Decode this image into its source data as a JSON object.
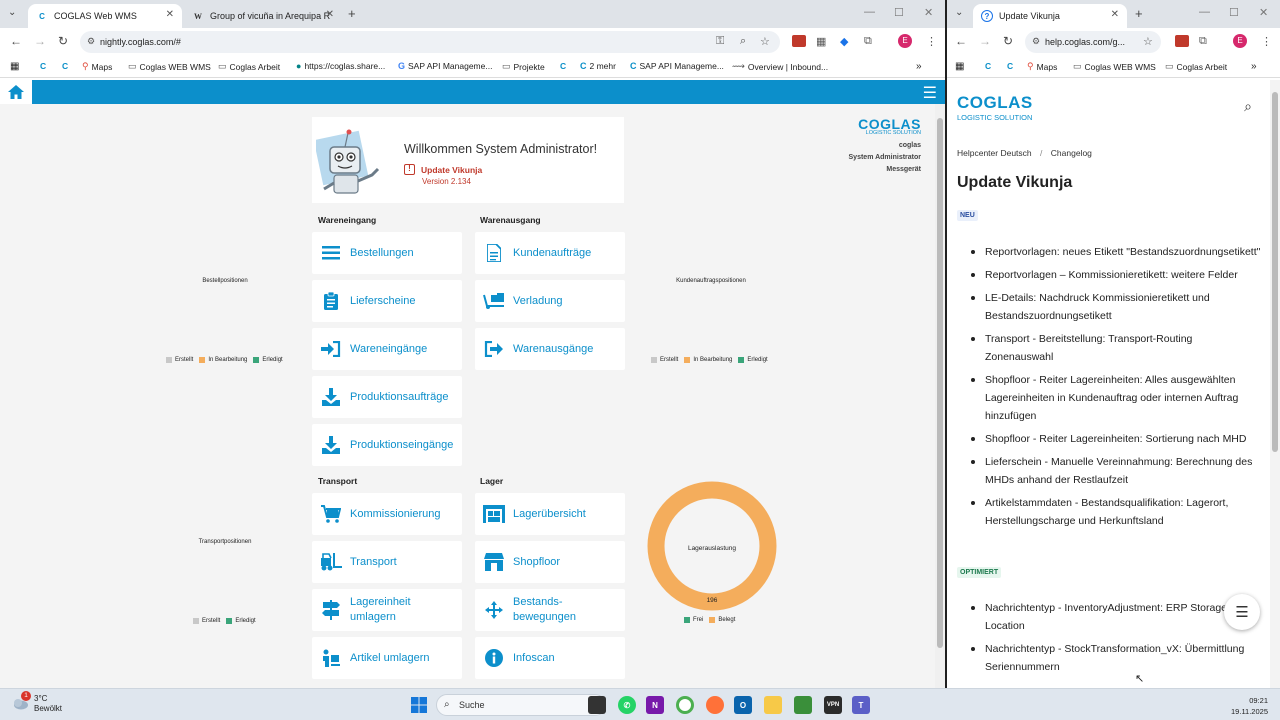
{
  "left_window": {
    "tabs": [
      {
        "title": "COGLAS Web WMS",
        "active": true
      },
      {
        "title": "Group of vicuña in Arequipa Re",
        "active": false
      }
    ],
    "url": "nightly.coglas.com/#",
    "bookmarks": [
      "Maps",
      "Coglas WEB WMS",
      "Coglas Arbeit",
      "https://coglas.share...",
      "SAP API Manageme...",
      "Projekte",
      "2 mehr",
      "SAP API Manageme...",
      "Overview | Inbound..."
    ]
  },
  "app": {
    "welcome_title": "Willkommen System Administrator!",
    "update_label": "Update Vikunja",
    "version": "Version 2.134",
    "brand_logo": "COGLAS",
    "brand_sub": "LOGISTIC SOLUTION",
    "user_lines": [
      "coglas",
      "System Administrator",
      "Messgerät"
    ],
    "sections": {
      "wareneingang": "Wareneingang",
      "warenausgang": "Warenausgang",
      "transport": "Transport",
      "lager": "Lager"
    },
    "cards": {
      "bestellungen": "Bestellungen",
      "lieferscheine": "Lieferscheine",
      "wareneingaenge": "Wareneingänge",
      "produktionsauftraege": "Produktionsaufträge",
      "produktionseingaenge": "Produktionseingänge",
      "kundenauftraege": "Kundenaufträge",
      "verladung": "Verladung",
      "warenausgaenge": "Warenausgänge",
      "kommissionierung": "Kommissionierung",
      "transport": "Transport",
      "lagereinheit_umlagern": "Lagereinheit umlagern",
      "artikel_umlagern": "Artikel umlagern",
      "lageruebersicht": "Lagerübersicht",
      "shopfloor": "Shopfloor",
      "bestandsbewegungen": "Bestands-bewegungen",
      "infoscan": "Infoscan"
    },
    "colors": {
      "accent": "#0c8fcb",
      "erstellt": "#c8c8c8",
      "in_bearbeitung": "#f4ad5c",
      "erledigt": "#3aa57a",
      "frei": "#3aa57a",
      "belegt": "#f4ad5c"
    }
  },
  "chart_data": [
    {
      "type": "pie",
      "title": "Bestellpositionen",
      "legend": [
        "Erstellt",
        "In Bearbeitung",
        "Erledigt"
      ],
      "values": []
    },
    {
      "type": "pie",
      "title": "Kundenauftragspositionen",
      "legend": [
        "Erstellt",
        "In Bearbeitung",
        "Erledigt"
      ],
      "values": []
    },
    {
      "type": "pie",
      "title": "Transportpositionen",
      "legend": [
        "Erstellt",
        "Erledigt"
      ],
      "values": []
    },
    {
      "type": "pie",
      "title": "Lagerauslastung",
      "legend": [
        "Frei",
        "Belegt"
      ],
      "categories": [
        "Frei",
        "Belegt"
      ],
      "values": [
        0,
        196
      ],
      "data_label": "196"
    }
  ],
  "right_window": {
    "tab_title": "Update Vikunja",
    "url": "help.coglas.com/g...",
    "bookmarks": [
      "Maps",
      "Coglas WEB WMS",
      "Coglas Arbeit"
    ],
    "logo": "COGLAS",
    "logo_sub": "LOGISTIC SOLUTION",
    "breadcrumb": [
      "Helpcenter Deutsch",
      "Changelog"
    ],
    "title": "Update Vikunja",
    "badge_new": "NEU",
    "new_items": [
      "Reportvorlagen: neues Etikett \"Bestandszuordnungsetikett\"",
      "Reportvorlagen – Kommissionieretikett: weitere Felder",
      "LE-Details: Nachdruck Kommissionieretikett und Bestandszuordnungsetikett",
      "Transport - Bereitstellung: Transport-Routing Zonenauswahl",
      "Shopfloor - Reiter Lagereinheiten: Alles ausgewählten Lagereinheiten in Kundenauftrag oder internen Auftrag hinzufügen",
      "Shopfloor - Reiter Lagereinheiten: Sortierung nach MHD",
      "Lieferschein - Manuelle Vereinnahmung: Berechnung des MHDs anhand der Restlaufzeit",
      "Artikelstammdaten - Bestandsqualifikation: Lagerort, Herstellungscharge und Herkunftsland"
    ],
    "badge_opt": "OPTIMIERT",
    "opt_items": [
      "Nachrichtentyp - InventoryAdjustment: ERP Storage Location",
      "Nachrichtentyp - StockTransformation_vX: Übermittlung Seriennummern"
    ]
  },
  "taskbar": {
    "weather_temp": "3°C",
    "weather_desc": "Bewölkt",
    "weather_badge": "1",
    "search": "Suche",
    "time": "09:21",
    "date": "19.11.2025"
  }
}
